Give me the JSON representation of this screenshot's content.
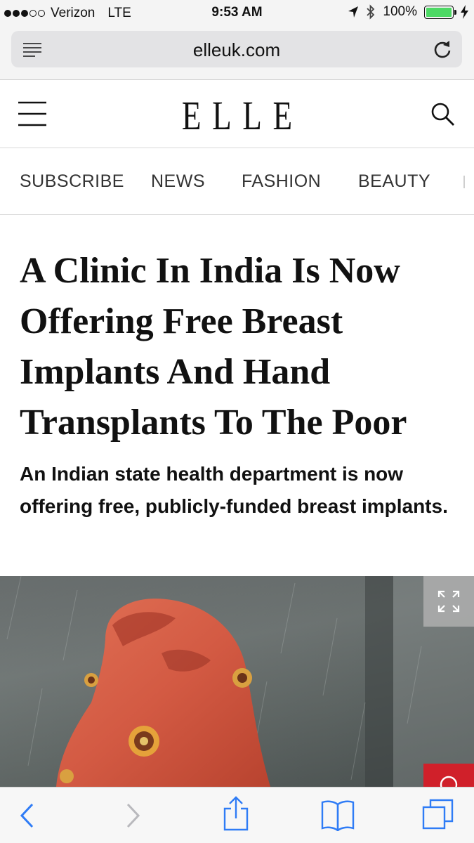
{
  "status_bar": {
    "carrier": "Verizon",
    "network": "LTE",
    "time": "9:53 AM",
    "battery": "100%",
    "battery_level": 1.0
  },
  "browser": {
    "url": "elleuk.com"
  },
  "site": {
    "logo": "ELLE"
  },
  "nav": {
    "items": [
      "SUBSCRIBE",
      "NEWS",
      "FASHION",
      "BEAUTY"
    ]
  },
  "article": {
    "headline": "A Clinic In India Is Now Offering Free Breast Implants And Hand Transplants To The Poor",
    "standfirst": "An Indian state health department is now offering free, publicly-funded breast implants."
  },
  "colors": {
    "battery": "#4cd964",
    "safari_blue": "#2f7cf6",
    "pin_red": "#d0202a"
  },
  "icons": [
    "signal-icon",
    "location-arrow-icon",
    "bluetooth-icon",
    "battery-icon",
    "charging-icon",
    "reader-icon",
    "reload-icon",
    "hamburger-menu-icon",
    "search-icon",
    "expand-icon",
    "pin-icon",
    "back-icon",
    "forward-icon",
    "share-icon",
    "bookmarks-icon",
    "tabs-icon"
  ]
}
